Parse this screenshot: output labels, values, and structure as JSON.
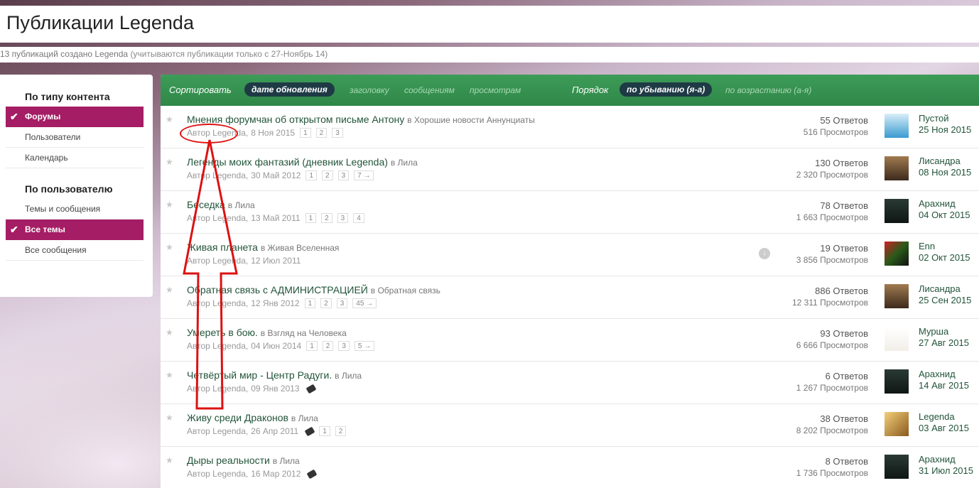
{
  "header": {
    "title": "Публикации Legenda"
  },
  "subheader": {
    "text": "13 публикаций создано Legenda",
    "note": "(учитываются публикации только с 27-Ноябрь 14)"
  },
  "sidebar": {
    "section1": "По типу контента",
    "items1": [
      "Форумы",
      "Пользователи",
      "Календарь"
    ],
    "section2": "По пользователю",
    "items2": [
      "Темы и сообщения",
      "Все темы",
      "Все сообщения"
    ]
  },
  "sortbar": {
    "sort_label": "Сортировать",
    "sort_options": [
      "дате обновления",
      "заголовку",
      "сообщениям",
      "просмотрам"
    ],
    "order_label": "Порядок",
    "order_options": [
      "по убыванию (я-а)",
      "по возрастанию (а-я)"
    ]
  },
  "rows": [
    {
      "title": "Мнения форумчан об открытом письме Антону",
      "in": "в Хорошие новости Аннунциаты",
      "author": "Автор Legenda,",
      "date": "8 Ноя 2015",
      "pages": [
        "1",
        "2",
        "3"
      ],
      "replies": "55 Ответов",
      "views": "516 Просмотров",
      "last_user": "Пустой",
      "last_date": "25 Ноя 2015"
    },
    {
      "title": "Легенды моих фантазий (дневник Legenda)",
      "in": "в Лила",
      "author": "Автор Legenda,",
      "date": "30 Май 2012",
      "pages": [
        "1",
        "2",
        "3",
        "7 →"
      ],
      "replies": "130 Ответов",
      "views": "2 320 Просмотров",
      "last_user": "Лисандра",
      "last_date": "08 Ноя 2015"
    },
    {
      "title": "Беседка",
      "in": "в Лила",
      "author": "Автор Legenda,",
      "date": "13 Май 2011",
      "pages": [
        "1",
        "2",
        "3",
        "4"
      ],
      "replies": "78 Ответов",
      "views": "1 663 Просмотров",
      "last_user": "Арахнид",
      "last_date": "04 Окт 2015"
    },
    {
      "title": "Живая планета",
      "in": "в Живая Вселенная",
      "author": "Автор Legenda,",
      "date": "12 Июл 2011",
      "pages": [],
      "replies": "19 Ответов",
      "views": "3 856 Просмотров",
      "last_user": "Enn",
      "last_date": "02 Окт 2015"
    },
    {
      "title": "Обратная связь с АДМИНИСТРАЦИЕЙ",
      "in": "в Обратная связь",
      "author": "Автор Legenda,",
      "date": "12 Янв 2012",
      "pages": [
        "1",
        "2",
        "3",
        "45 →"
      ],
      "replies": "886 Ответов",
      "views": "12 311 Просмотров",
      "last_user": "Лисандра",
      "last_date": "25 Сен 2015"
    },
    {
      "title": "Умереть в бою.",
      "in": "в Взгляд на Человека",
      "author": "Автор Legenda,",
      "date": "04 Июн 2014",
      "pages": [
        "1",
        "2",
        "3",
        "5 →"
      ],
      "replies": "93 Ответов",
      "views": "6 666 Просмотров",
      "last_user": "Мурша",
      "last_date": "27 Авг 2015"
    },
    {
      "title": "Четвёртый мир - Центр Радуги.",
      "in": "в Лила",
      "author": "Автор Legenda,",
      "date": "09 Янв 2013",
      "pages": [],
      "replies": "6 Ответов",
      "views": "1 267 Просмотров",
      "last_user": "Арахнид",
      "last_date": "14 Авг 2015"
    },
    {
      "title": "Живу среди Драконов",
      "in": "в Лила",
      "author": "Автор Legenda,",
      "date": "26 Апр 2011",
      "pages": [
        "1",
        "2"
      ],
      "replies": "38 Ответов",
      "views": "8 202 Просмотров",
      "last_user": "Legenda",
      "last_date": "03 Авг 2015"
    },
    {
      "title": "Дыры реальности",
      "in": "в Лила",
      "author": "Автор Legenda,",
      "date": "16 Мар 2012",
      "pages": [],
      "replies": "8 Ответов",
      "views": "1 736 Просмотров",
      "last_user": "Арахнид",
      "last_date": "31 Июл 2015"
    }
  ],
  "colors": {
    "accent_green": "#2f8748",
    "sidebar_active": "#a51d64",
    "annotation": "#dd1111"
  }
}
